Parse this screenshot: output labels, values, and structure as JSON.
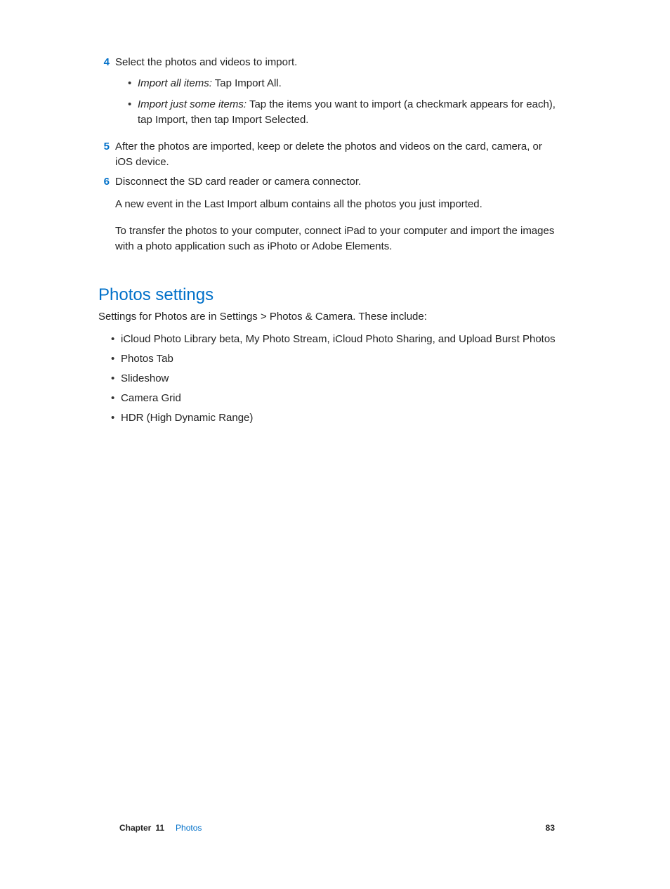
{
  "steps": {
    "s4": {
      "num": "4",
      "text": "Select the photos and videos to import.",
      "sub": [
        {
          "em": "Import all items:",
          "rest": "  Tap Import All."
        },
        {
          "em": "Import just some items:",
          "rest": "  Tap the items you want to import (a checkmark appears for each), tap Import, then tap Import Selected."
        }
      ]
    },
    "s5": {
      "num": "5",
      "text": "After the photos are imported, keep or delete the photos and videos on the card, camera, or iOS device."
    },
    "s6": {
      "num": "6",
      "text": "Disconnect the SD card reader or camera connector.",
      "paras": [
        "A new event in the Last Import album contains all the photos you just imported.",
        "To transfer the photos to your computer, connect iPad to your computer and import the images with a photo application such as iPhoto or Adobe Elements."
      ]
    }
  },
  "section": {
    "heading": "Photos settings",
    "intro": "Settings for Photos are in Settings > Photos & Camera. These include:",
    "bullets": [
      "iCloud Photo Library beta, My Photo Stream, iCloud Photo Sharing, and Upload Burst Photos",
      "Photos Tab",
      "Slideshow",
      "Camera Grid",
      "HDR (High Dynamic Range)"
    ]
  },
  "footer": {
    "chapter_label": "Chapter",
    "chapter_num": "11",
    "chapter_name": "Photos",
    "page": "83"
  }
}
